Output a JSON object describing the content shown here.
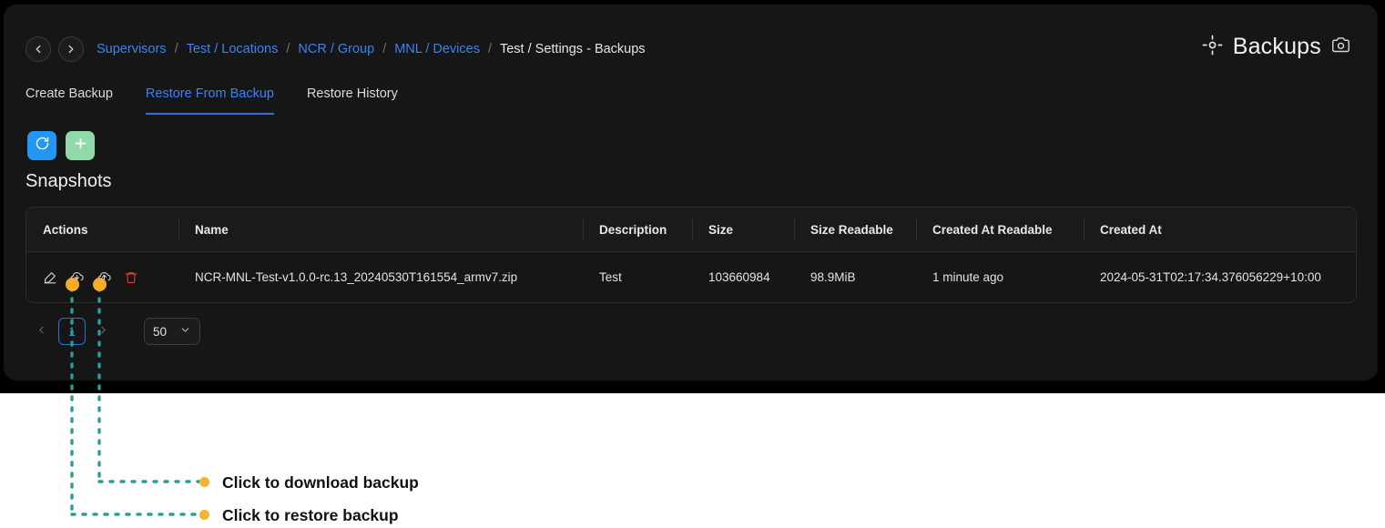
{
  "header": {
    "nav_back_icon": "chevron-left-icon",
    "nav_forward_icon": "chevron-right-icon",
    "breadcrumb": [
      {
        "label": "Supervisors",
        "current": false
      },
      {
        "label": "Test / Locations",
        "current": false
      },
      {
        "label": "NCR / Group",
        "current": false
      },
      {
        "label": "MNL / Devices",
        "current": false
      },
      {
        "label": "Test / Settings - Backups",
        "current": true
      }
    ],
    "separator": "/",
    "title": "Backups",
    "title_left_icon": "crosshair-target-icon",
    "title_right_icon": "camera-icon"
  },
  "tabs": [
    {
      "label": "Create Backup",
      "active": false
    },
    {
      "label": "Restore From Backup",
      "active": true
    },
    {
      "label": "Restore History",
      "active": false
    }
  ],
  "toolbar": {
    "refresh_icon": "refresh-icon",
    "add_icon": "plus-icon",
    "refresh_color": "#2196f3",
    "add_color": "#92d9a9"
  },
  "section": {
    "title": "Snapshots"
  },
  "table": {
    "columns": [
      "Actions",
      "Name",
      "Description",
      "Size",
      "Size Readable",
      "Created At Readable",
      "Created At"
    ],
    "row_actions": [
      {
        "name": "edit-icon",
        "title": "Edit"
      },
      {
        "name": "cloud-download-icon",
        "title": "Download backup"
      },
      {
        "name": "cloud-restore-icon",
        "title": "Restore backup"
      },
      {
        "name": "delete-icon",
        "title": "Delete"
      }
    ],
    "rows": [
      {
        "name": "NCR-MNL-Test-v1.0.0-rc.13_20240530T161554_armv7.zip",
        "description": "Test",
        "size": "103660984",
        "size_readable": "98.9MiB",
        "created_at_readable": "1 minute ago",
        "created_at": "2024-05-31T02:17:34.376056229+10:00"
      }
    ]
  },
  "pagination": {
    "prev_icon": "chevron-left-icon",
    "next_icon": "chevron-right-icon",
    "current_page": "1",
    "page_size": "50",
    "page_size_caret": "chevron-down-icon"
  },
  "annotations": {
    "accent_color": "#2a9d9b",
    "dot_color": "#f5b335",
    "items": [
      {
        "label": "Click to download backup"
      },
      {
        "label": "Click to restore backup"
      }
    ]
  }
}
